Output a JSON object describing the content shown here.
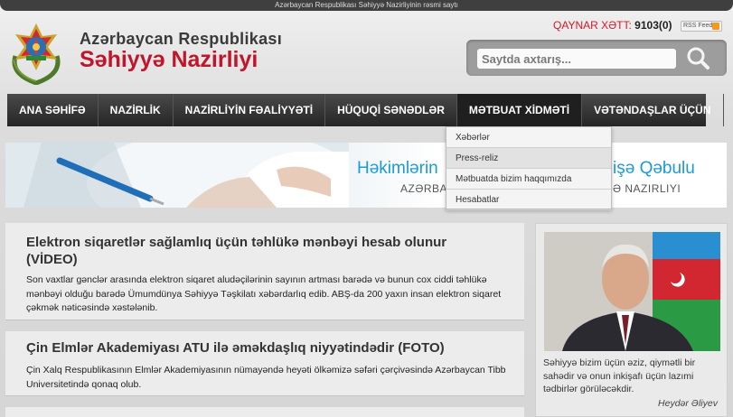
{
  "topbar": {
    "text": "Azərbaycan Respublikası Səhiyyə Nazirliyinin rəsmi saytı"
  },
  "header": {
    "title_line1": "Azərbaycan Respublikası",
    "title_line2": "Səhiyyə Nazirliyi",
    "hotline_label": "QAYNAR XƏTT:",
    "hotline_number": "9103(0)",
    "rss_label": "RSS Feed"
  },
  "search": {
    "placeholder": "Saytda axtarış..."
  },
  "nav": {
    "items": [
      {
        "label": "ANA SƏHİFƏ"
      },
      {
        "label": "NAZİRLİK"
      },
      {
        "label": "NAZİRLİYİN FƏALİYYƏTİ"
      },
      {
        "label": "HÜQUQİ SƏNƏDLƏR"
      },
      {
        "label": "MƏTBUAT XİDMƏTİ"
      },
      {
        "label": "VƏTƏNDAŞLAR ÜÇÜN"
      }
    ]
  },
  "dropdown": {
    "items": [
      {
        "label": "Xəbərlər"
      },
      {
        "label": "Press-reliz"
      },
      {
        "label": "Mətbuatda bizim haqqımızda"
      },
      {
        "label": "Hesabatlar"
      }
    ]
  },
  "banner": {
    "title_left": "Həkimlərin",
    "title_right": "işə Qəbulu",
    "subtitle_left": "AZƏRBA",
    "subtitle_right": "Ə NAZIRLIYI"
  },
  "news": [
    {
      "title": "Elektron siqaretlər sağlamlıq üçün təhlükə mənbəyi hesab olunur (VİDEO)",
      "summary": "Son vaxtlar gənclər arasında elektron siqaret aludəçilərinin sayının artması barədə və bunun cox ciddi təhlükə mənbəyi olduğu barədə Ümumdünya Səhiyyə Təşkilatı xəbərdarlıq edib. ABŞ-da 200 yaxın insan elektron siqaret çəkmək nəticəsində xəstələnib."
    },
    {
      "title": "Çin Elmlər Akademiyası ATU ilə əməkdaşlıq niyyətindədir (FOTO)",
      "summary": "Çin Xalq Respublikasının Elmlər Akademiyasının nümayəndə heyəti ölkəmizə səfəri çərçivəsində Azərbaycan Tibb Universitetində qonaq olub."
    }
  ],
  "sidebar": {
    "quote": "Səhiyyə bizim üçün əziz, qiymətli bir sahədir və onun inkişafı üçün lazımi tədbirlər görüləcəkdir.",
    "author": "Heydər Əliyev"
  },
  "colors": {
    "brand_red": "#c0152a",
    "nav_bg": "#2e2e2e",
    "banner_blue": "#1a9ad6"
  }
}
